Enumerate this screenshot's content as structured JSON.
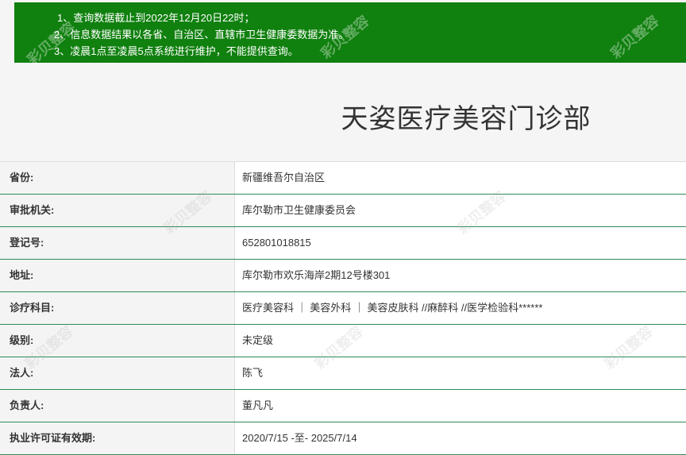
{
  "notice": {
    "line1": "1、查询数据截止到2022年12月20日22时；",
    "line2": "2、信息数据结果以各省、自治区、直辖市卫生健康委数据为准。",
    "line3": "3、凌晨1点至凌晨5点系统进行维护，不能提供查询。"
  },
  "watermark_text": "彩贝整容",
  "title": "天姿医疗美容门诊部",
  "rows": [
    {
      "label": "省份:",
      "value": "新疆维吾尔自治区"
    },
    {
      "label": "审批机关:",
      "value": "库尔勒市卫生健康委员会"
    },
    {
      "label": "登记号:",
      "value": "652801018815"
    },
    {
      "label": "地址:",
      "value": "库尔勒市欢乐海岸2期12号楼301"
    },
    {
      "label": "诊疗科目:",
      "value": "医疗美容科 ｜ 美容外科 ｜ 美容皮肤科 //麻醉科 //医学检验科******"
    },
    {
      "label": "级别:",
      "value": "未定级"
    },
    {
      "label": "法人:",
      "value": "陈飞"
    },
    {
      "label": "负责人:",
      "value": "董凡凡"
    },
    {
      "label": "执业许可证有效期:",
      "value": "2020/7/15 -至- 2025/7/14"
    }
  ]
}
